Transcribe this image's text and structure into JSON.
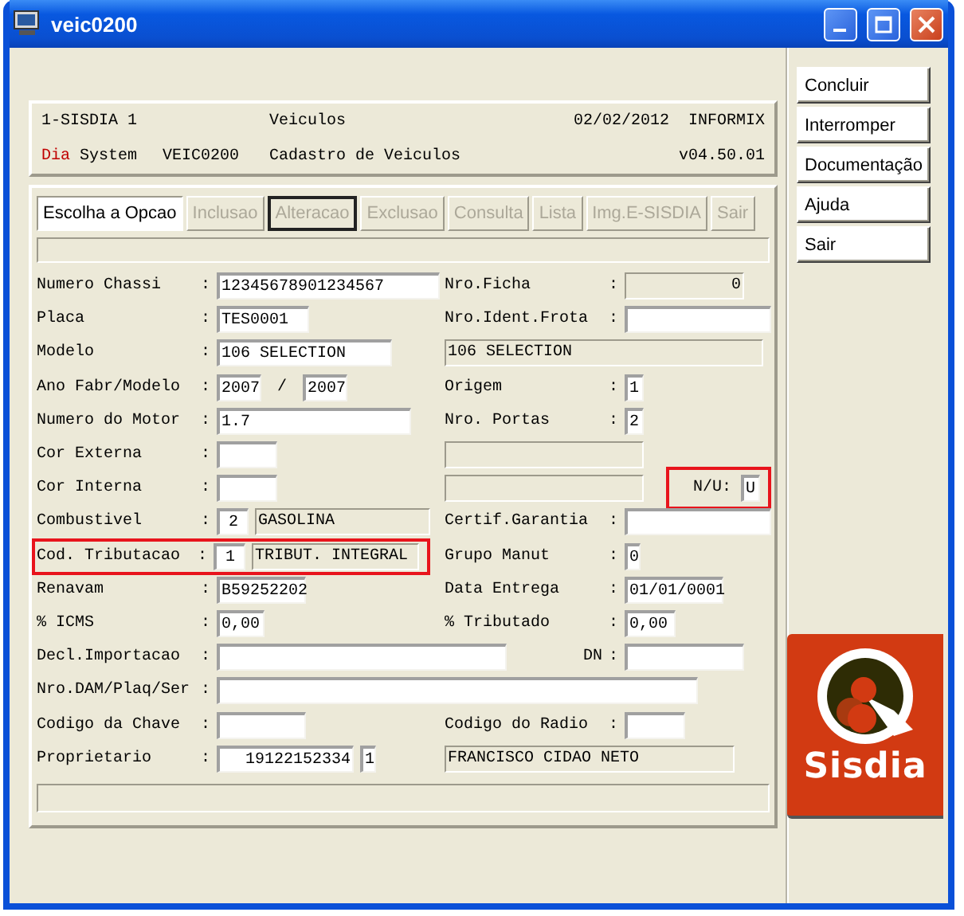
{
  "window": {
    "title": "veic0200"
  },
  "header": {
    "line1": [
      "1-SISDIA 1",
      "Veiculos",
      "02/02/2012",
      "INFORMIX"
    ],
    "brand_prefix": "Dia",
    "brand_suffix": "System",
    "line2": [
      "VEIC0200",
      "Cadastro de Veiculos",
      "v04.50.01"
    ]
  },
  "menu": [
    {
      "label": "Escolha a Opcao",
      "kind": "prompt",
      "disabled": false,
      "selected": false
    },
    {
      "label": "Inclusao",
      "kind": "button",
      "disabled": true,
      "selected": false
    },
    {
      "label": "Alteracao",
      "kind": "button",
      "disabled": true,
      "selected": true
    },
    {
      "label": "Exclusao",
      "kind": "button",
      "disabled": true,
      "selected": false
    },
    {
      "label": "Consulta",
      "kind": "button",
      "disabled": true,
      "selected": false
    },
    {
      "label": "Lista",
      "kind": "button",
      "disabled": true,
      "selected": false
    },
    {
      "label": "Img.E-SISDIA",
      "kind": "button",
      "disabled": true,
      "selected": false
    },
    {
      "label": "Sair",
      "kind": "button",
      "disabled": true,
      "selected": false
    }
  ],
  "form": [
    {
      "left": {
        "label": "Numero Chassi",
        "colon": ":",
        "fields": [
          {
            "kind": "input",
            "value": "12345678901234567"
          }
        ]
      },
      "right": {
        "label": "Nro.Ficha",
        "colon": ":",
        "fields": [
          {
            "kind": "display",
            "value": "0"
          }
        ]
      }
    },
    {
      "left": {
        "label": "Placa",
        "colon": ":",
        "fields": [
          {
            "kind": "input",
            "value": "TES0001"
          }
        ]
      },
      "right": {
        "label": "Nro.Ident.Frota",
        "colon": ":",
        "fields": [
          {
            "kind": "input"
          }
        ]
      }
    },
    {
      "left": {
        "label": "Modelo",
        "colon": ":",
        "fields": [
          {
            "kind": "input",
            "value": "106 SELECTION"
          }
        ]
      },
      "right": {
        "fields": [
          {
            "kind": "display",
            "value": "106 SELECTION"
          }
        ]
      }
    },
    {
      "left": {
        "label": "Ano Fabr/Modelo",
        "colon": ":",
        "fields": [
          {
            "kind": "input",
            "value": "2007"
          },
          {
            "kind": "text",
            "value": "/"
          },
          {
            "kind": "input",
            "value": "2007"
          }
        ]
      },
      "right": {
        "label": "Origem",
        "colon": ":",
        "fields": [
          {
            "kind": "input",
            "value": "1"
          }
        ]
      }
    },
    {
      "left": {
        "label": "Numero do Motor",
        "colon": ":",
        "fields": [
          {
            "kind": "input",
            "value": "1.7"
          }
        ]
      },
      "right": {
        "label": "Nro. Portas",
        "colon": ":",
        "fields": [
          {
            "kind": "input",
            "value": "2"
          }
        ]
      }
    },
    {
      "left": {
        "label": "Cor Externa",
        "colon": ":",
        "fields": [
          {
            "kind": "input"
          }
        ]
      },
      "right": {
        "fields": [
          {
            "kind": "display"
          }
        ]
      }
    },
    {
      "left": {
        "label": "Cor Interna",
        "colon": ":",
        "fields": [
          {
            "kind": "input"
          }
        ]
      },
      "right": {
        "fields": [
          {
            "kind": "display"
          }
        ]
      },
      "flag": {
        "label": "N/U:",
        "value": "U",
        "highlighted": true
      }
    },
    {
      "left": {
        "label": "Combustivel",
        "colon": ":",
        "fields": [
          {
            "kind": "input",
            "value": "2"
          },
          {
            "kind": "display",
            "value": "GASOLINA"
          }
        ]
      },
      "right": {
        "label": "Certif.Garantia",
        "colon": ":",
        "fields": [
          {
            "kind": "input"
          }
        ]
      }
    },
    {
      "left": {
        "label": "Cod. Tributacao",
        "colon": ":",
        "highlighted": true,
        "fields": [
          {
            "kind": "input",
            "value": "1"
          },
          {
            "kind": "display",
            "value": "TRIBUT. INTEGRAL"
          }
        ]
      },
      "right": {
        "label": "Grupo Manut",
        "colon": ":",
        "fields": [
          {
            "kind": "input",
            "value": "0"
          }
        ]
      }
    },
    {
      "left": {
        "label": "Renavam",
        "colon": ":",
        "fields": [
          {
            "kind": "input",
            "value": "B59252202"
          }
        ]
      },
      "right": {
        "label": "Data Entrega",
        "colon": ":",
        "fields": [
          {
            "kind": "input",
            "value": "01/01/0001"
          }
        ]
      }
    },
    {
      "left": {
        "label": "% ICMS",
        "colon": ":",
        "fields": [
          {
            "kind": "input",
            "value": "0,00"
          }
        ]
      },
      "right": {
        "label": "% Tributado",
        "colon": ":",
        "fields": [
          {
            "kind": "input",
            "value": "0,00"
          }
        ]
      }
    },
    {
      "left": {
        "label": "Decl.Importacao",
        "colon": ":",
        "fields": [
          {
            "kind": "input"
          }
        ]
      },
      "right": {
        "label": "DN",
        "colon": ":",
        "fields": [
          {
            "kind": "input"
          }
        ]
      }
    },
    {
      "left": {
        "label": "Nro.DAM/Plaq/Ser",
        "colon": ":",
        "fields": [
          {
            "kind": "input"
          }
        ]
      }
    },
    {
      "left": {
        "label": "Codigo da Chave",
        "colon": ":",
        "fields": [
          {
            "kind": "input"
          }
        ]
      },
      "right": {
        "label": "Codigo do Radio",
        "colon": ":",
        "fields": [
          {
            "kind": "input"
          }
        ]
      }
    },
    {
      "left": {
        "label": "Proprietario",
        "colon": ":",
        "fields": [
          {
            "kind": "input",
            "value": "19122152334"
          },
          {
            "kind": "input",
            "value": "1"
          }
        ]
      },
      "right": {
        "fields": [
          {
            "kind": "display",
            "value": "FRANCISCO CIDAO NETO"
          }
        ]
      }
    }
  ],
  "actions": [
    {
      "label": "Concluir"
    },
    {
      "label": "Interromper"
    },
    {
      "label": "Documentação"
    },
    {
      "label": "Ajuda"
    },
    {
      "label": "Sair"
    }
  ],
  "logo": {
    "text": "Sisdia"
  }
}
